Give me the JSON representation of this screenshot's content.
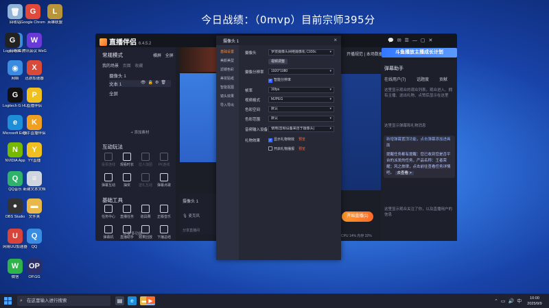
{
  "banner": {
    "text": "今日战绩：（0mvp）目前宗师395分"
  },
  "desktop_icons": [
    {
      "name": "回收站",
      "glyph": "🗑",
      "color": "#8fb4d8"
    },
    {
      "name": "Google Chrome",
      "glyph": "G",
      "color": "#e04a3a"
    },
    {
      "name": "英雄联盟",
      "glyph": "L",
      "color": "#b8953a"
    },
    {
      "name": "此电脑",
      "glyph": "▭",
      "color": "#3a8ce0"
    },
    {
      "name": "腾讯会议 WeGame",
      "glyph": "W",
      "color": "#6a3ad8"
    },
    {
      "name": "Logitech G",
      "glyph": "G",
      "color": "#222"
    },
    {
      "name": "网络",
      "glyph": "◉",
      "color": "#3a8ce0"
    },
    {
      "name": "迅游加速器",
      "glyph": "X",
      "color": "#d84a3a"
    },
    {
      "name": "Logitech G HUB",
      "glyph": "G",
      "color": "#111"
    },
    {
      "name": "直播伴侣",
      "glyph": "P",
      "color": "#f0c020"
    },
    {
      "name": "Microsoft Edge",
      "glyph": "e",
      "color": "#1f8ed8"
    },
    {
      "name": "快手直播伴侣",
      "glyph": "K",
      "color": "#f0a020"
    },
    {
      "name": "NVIDIA App",
      "glyph": "N",
      "color": "#76b900"
    },
    {
      "name": "YY直播",
      "glyph": "Y",
      "color": "#f0c020"
    },
    {
      "name": "QQ音乐",
      "glyph": "Q",
      "color": "#2fb36a"
    },
    {
      "name": "新建文本文档",
      "glyph": "≡",
      "color": "#cfd6e0"
    },
    {
      "name": "OBS Studio",
      "glyph": "●",
      "color": "#333"
    },
    {
      "name": "文件夹",
      "glyph": "▬",
      "color": "#e8b84a"
    },
    {
      "name": "网易UU加速器",
      "glyph": "U",
      "color": "#d8443a"
    },
    {
      "name": "QQ",
      "glyph": "Q",
      "color": "#3a8ce0"
    },
    {
      "name": "微信",
      "glyph": "W",
      "color": "#2fb34a"
    },
    {
      "name": "OP.GG",
      "glyph": "OP",
      "color": "#2a2f6a"
    }
  ],
  "app": {
    "title": "直播伴侣",
    "version": "6.4.5.2",
    "mode_label": "常规模式",
    "mode_right": [
      "横屏",
      "全屏"
    ],
    "scene_tabs": [
      "我的场景",
      "页面",
      "收藏"
    ],
    "scenes": [
      "摄像头 1",
      "文本 1",
      "全屏"
    ],
    "add_material": "+ 添加素材",
    "interact_title": "互动玩法",
    "interact_items": [
      "投票连线",
      "观看时长",
      "拉人加团",
      "PK连线",
      "弹幕互动",
      "抽奖",
      "送礼互动",
      "弹幕点歌"
    ],
    "tools_title": "基础工具",
    "tools_items": [
      "任务中心",
      "直播任务",
      "道具赛",
      "正版音乐",
      "弹幕机",
      "直播助手",
      "效果回放",
      "下播总结"
    ],
    "more_functions": "更多功能",
    "camera_label": "摄像头 1",
    "mic_label": "麦克风",
    "share_hint": "分享直播间",
    "start_button": "开始直播(1)",
    "stats": "CPU 14%  内存 32%",
    "live_tabs": "开播规范 | 本场数据",
    "ad_banner": "斗鱼播放主播成长计划"
  },
  "barrage_panel": {
    "title": "弹幕助手",
    "tabs": [
      "在线用户(7)",
      "话题度",
      "贡献"
    ],
    "text1": "这里显示观众的观众列表，观众进入、拥有主播、送出礼物、点赞后显示在这里",
    "text2": "这里显示弹幕和礼物消息",
    "notice1": "新增弹幕置顶功能，点击弹幕添加进画面",
    "notice2": "提醒任务都有提醒：您已收到您是否平台的派发的任务，产品名称：王者荣耀；风之旅律，点击前往查看任务详情吧。",
    "notice_link": "去查看 >",
    "text3": "这里显示观众关注了你，以及直播用户的信息"
  },
  "dialog": {
    "title": "摄像头 1",
    "close": "×",
    "side_items": [
      "基础设置",
      "美颜美型",
      "滤镜色彩",
      "美妆贴纸",
      "智能抠图",
      "镜头效果",
      "导入导出"
    ],
    "fields": [
      {
        "label": "摄像头",
        "value": "罗技摄像头网络摄像机 C930c"
      },
      {
        "label": "",
        "value": "视频调整",
        "kind": "button"
      },
      {
        "label": "摄像分辨率",
        "value": "1920*1080"
      },
      {
        "label": "",
        "value": "智能分辨率",
        "kind": "check",
        "checked": true
      },
      {
        "label": "帧率",
        "value": "30fps"
      },
      {
        "label": "视频格式",
        "value": "MJPEG"
      },
      {
        "label": "色彩空间",
        "value": "默认"
      },
      {
        "label": "色彩范围",
        "value": "默认"
      },
      {
        "label": "音频输入设备",
        "value": "使用(音频设备来自于摄像头)"
      },
      {
        "label": "礼物效果",
        "value": "显示礼物特效",
        "kind": "check",
        "checked": true,
        "link": "预览"
      },
      {
        "label": "",
        "value": "开启礼物播报",
        "kind": "check",
        "checked": false,
        "link": "预览"
      }
    ]
  },
  "taskbar": {
    "search_placeholder": "在这里输入你要搜索的内容",
    "search_label": "在这里输入进行搜索",
    "time": "10:00",
    "date": "2025/9/9"
  },
  "colors": {
    "accent": "#ff8a2c",
    "link": "#ff6c3a",
    "brand_blue": "#3478ff"
  }
}
